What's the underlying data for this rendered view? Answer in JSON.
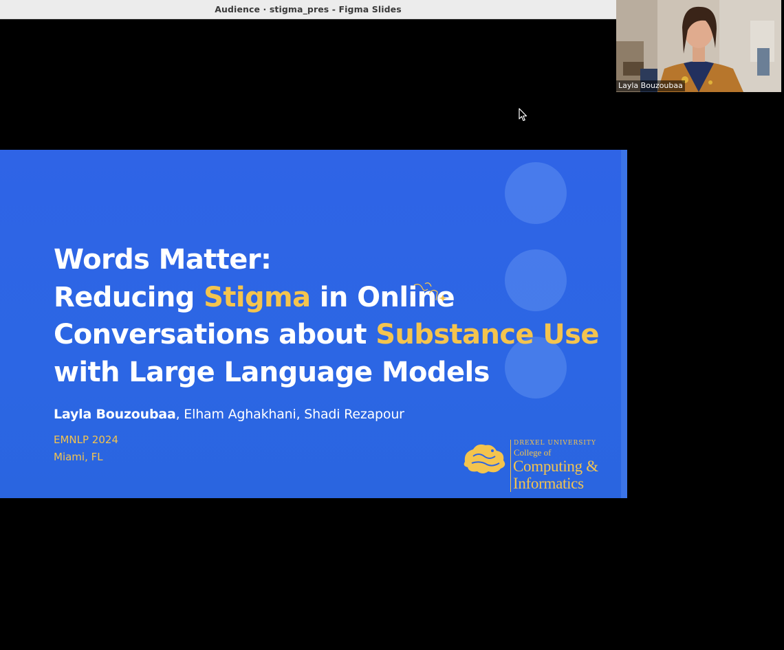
{
  "window": {
    "title": "Audience · stigma_pres - Figma Slides"
  },
  "video": {
    "participant_name": "Layla Bouzoubaa"
  },
  "slide": {
    "title": {
      "line1": "Words Matter:",
      "line2_pre": "Reducing ",
      "line2_highlight": "Stigma",
      "line2_post": " in Online",
      "line3_pre": "Conversations about ",
      "line3_highlight": "Substance Use",
      "line4": "with Large Language Models"
    },
    "authors": {
      "lead": "Layla Bouzoubaa",
      "others": ", Elham Aghakhani, Shadi Rezapour"
    },
    "venue": {
      "conference": "EMNLP 2024",
      "location": "Miami, FL"
    },
    "logo": {
      "university": "DREXEL UNIVERSITY",
      "college": "College of",
      "dept_line1": "Computing &",
      "dept_line2": "Informatics"
    },
    "colors": {
      "background": "#2d64e3",
      "accent": "#f4c44e",
      "text": "#ffffff"
    }
  },
  "icons": {
    "cursor": "arrow-cursor-icon",
    "sparkle": "sparkle-doodle-icon",
    "logo": "drexel-dragon-icon"
  }
}
